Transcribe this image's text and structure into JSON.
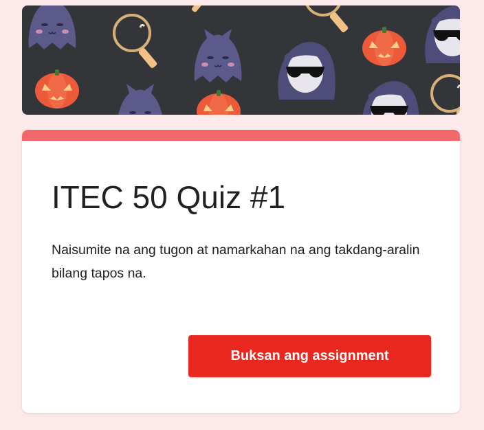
{
  "form": {
    "title": "ITEC 50 Quiz #1",
    "message": "Naisumite na ang tugon at namarkahan na ang takdang-aralin bilang tapos na.",
    "open_button_label": "Buksan ang assignment"
  },
  "colors": {
    "page_background": "#fde8ea",
    "banner_background": "#333538",
    "accent": "#f2676a",
    "button": "#e8281f"
  },
  "banner": {
    "theme": "halloween",
    "icons": [
      "ghost-icon",
      "magnifying-glass-icon",
      "jack-o-lantern-icon",
      "sunglasses-skull-icon"
    ]
  }
}
